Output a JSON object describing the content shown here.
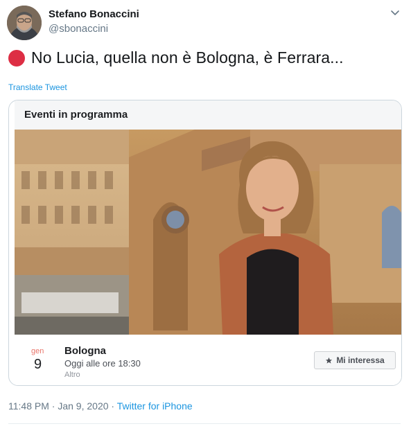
{
  "author": {
    "display_name": "Stefano Bonaccini",
    "handle": "@sbonaccini",
    "avatar_icon": "profile-photo"
  },
  "tweet": {
    "emoji_icon": "red-circle",
    "text": "No Lucia, quella non è Bologna, è Ferrara...",
    "translate_label": "Translate Tweet"
  },
  "event_card": {
    "header": "Eventi in programma",
    "month": "gen",
    "day": "9",
    "city": "Bologna",
    "time": "Oggi alle ore 18:30",
    "category": "Altro",
    "interest_label": "Mi interessa"
  },
  "meta": {
    "time": "11:48 PM",
    "sep1": " · ",
    "date": "Jan 9, 2020",
    "sep2": " · ",
    "source": "Twitter for iPhone"
  },
  "colors": {
    "link": "#1b95e0",
    "secondary_text": "#657786",
    "red_dot": "#dd2e44"
  }
}
